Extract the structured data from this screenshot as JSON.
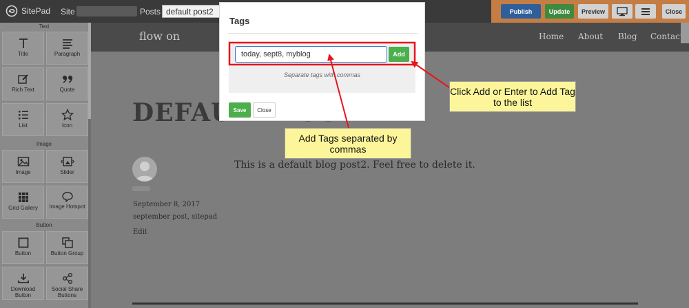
{
  "topbar": {
    "app_name": "SitePad",
    "site_label": "Site :",
    "posts_label": "Posts :",
    "posts_selected": "default post2",
    "publish_label": "Publish",
    "update_label": "Update",
    "preview_label": "Preview",
    "close_label": "Close"
  },
  "sidebar": {
    "sections": [
      {
        "label": "Text",
        "widgets": [
          {
            "label": "Title",
            "icon": "title-icon"
          },
          {
            "label": "Paragraph",
            "icon": "paragraph-icon"
          },
          {
            "label": "Rich Text",
            "icon": "rich-text-icon"
          },
          {
            "label": "Quote",
            "icon": "quote-icon"
          },
          {
            "label": "List",
            "icon": "list-icon"
          },
          {
            "label": "Icon",
            "icon": "star-icon"
          }
        ]
      },
      {
        "label": "Image",
        "widgets": [
          {
            "label": "Image",
            "icon": "image-icon"
          },
          {
            "label": "Slider",
            "icon": "slider-icon"
          },
          {
            "label": "Grid Gallery",
            "icon": "grid-gallery-icon"
          },
          {
            "label": "Image Hotspot",
            "icon": "hotspot-icon"
          }
        ]
      },
      {
        "label": "Button",
        "widgets": [
          {
            "label": "Button",
            "icon": "button-icon"
          },
          {
            "label": "Button Group",
            "icon": "button-group-icon"
          },
          {
            "label": "Download Button",
            "icon": "download-icon"
          },
          {
            "label": "Social Share Buttons",
            "icon": "share-icon"
          }
        ]
      }
    ]
  },
  "page": {
    "brand": "flow on",
    "nav": [
      "Home",
      "About",
      "Blog",
      "Contact"
    ],
    "post_title": "DEFAULT POST2",
    "post_body": "This is a default blog post2. Feel free to delete it.",
    "post_date": "September 8, 2017",
    "post_tags": "september post, sitepad",
    "edit_label": "Edit"
  },
  "modal": {
    "title": "Tags",
    "input_value": "today, sept8, myblog",
    "add_label": "Add",
    "hint": "Separate tags with commas",
    "save_label": "Save",
    "close_label": "Close"
  },
  "callouts": {
    "add": "Click Add or Enter to Add Tag to the list",
    "tags": "Add Tags separated by commas"
  },
  "colors": {
    "annotation_red": "#e8141b",
    "callout_yellow": "#fdf59a",
    "add_green": "#4cae4c",
    "publish_blue": "#2f5f9a",
    "actions_orange": "#c47e45"
  }
}
